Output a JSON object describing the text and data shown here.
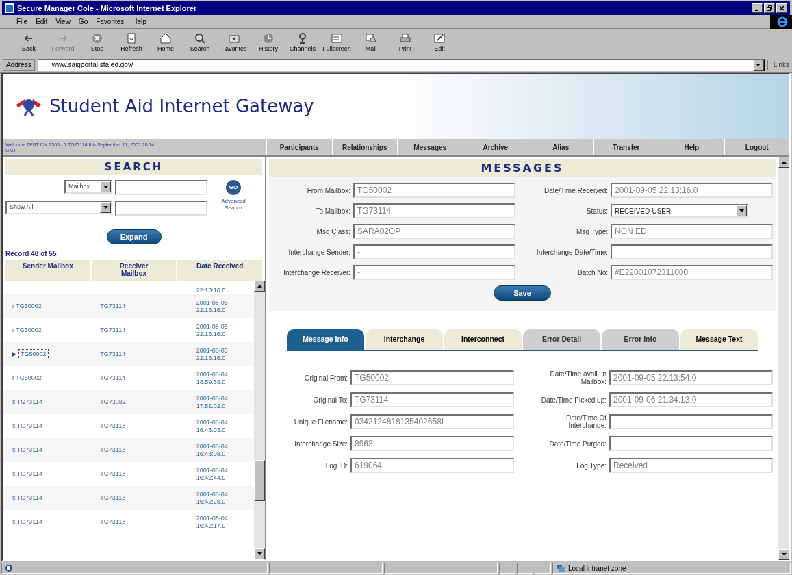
{
  "window": {
    "title": "Secure Manager Cole - Microsoft Internet Explorer"
  },
  "menu": [
    "File",
    "Edit",
    "View",
    "Go",
    "Favorites",
    "Help"
  ],
  "toolbar": [
    {
      "label": "Back",
      "kind": "back",
      "disabled": false
    },
    {
      "label": "Forward",
      "kind": "forward",
      "disabled": true
    },
    {
      "label": "Stop",
      "kind": "stop",
      "disabled": false
    },
    {
      "label": "Refresh",
      "kind": "refresh",
      "disabled": false
    },
    {
      "label": "Home",
      "kind": "home",
      "disabled": false
    },
    {
      "label": "Search",
      "kind": "search",
      "disabled": false
    },
    {
      "label": "Favorites",
      "kind": "favorites",
      "disabled": false
    },
    {
      "label": "History",
      "kind": "history",
      "disabled": false
    },
    {
      "label": "Channels",
      "kind": "channels",
      "disabled": false
    },
    {
      "label": "Fullscreen",
      "kind": "fullscreen",
      "disabled": false
    },
    {
      "label": "Mail",
      "kind": "mail",
      "disabled": false
    },
    {
      "label": "Print",
      "kind": "print",
      "disabled": false
    },
    {
      "label": "Edit",
      "kind": "edit",
      "disabled": false
    }
  ],
  "address": {
    "label": "Address",
    "value": "www.saigportal.sfa.ed.gov/",
    "links": "Links"
  },
  "site": {
    "title": "Student Aid Internet Gateway",
    "welcome": "Welcome TEST CM 2365 - 1 TG73114   It is September 17, 2001 20:14 GMT"
  },
  "nav": [
    "Participants",
    "Relationships",
    "Messages",
    "Archive",
    "Alias",
    "Transfer",
    "Help",
    "Logout"
  ],
  "search": {
    "heading": "SEARCH",
    "field_select": "Mailbox",
    "filter_select": "Show All",
    "go": "GO",
    "advanced": "Advanced Search",
    "expand": "Expand",
    "record": "Record 48 of 55",
    "columns": [
      "Sender Mailbox",
      "Receiver Mailbox",
      "Date Received"
    ],
    "rows": [
      {
        "prefix": "",
        "sender": "",
        "receiver": "",
        "date": "22:13:16.0",
        "selected": false
      },
      {
        "prefix": "r",
        "sender": "TG50002",
        "receiver": "TG73114",
        "date": "2001-08-05 22:13:16.0",
        "selected": false
      },
      {
        "prefix": "r",
        "sender": "TG50002",
        "receiver": "TG73114",
        "date": "2001-08-05 22:13:16.0",
        "selected": false
      },
      {
        "prefix": "",
        "sender": "TG50002",
        "receiver": "TG73114",
        "date": "2001-08-05 22:13:16.0",
        "selected": true
      },
      {
        "prefix": "r",
        "sender": "TG50002",
        "receiver": "TG73114",
        "date": "2001-08-04 18:59:38.0",
        "selected": false
      },
      {
        "prefix": "s",
        "sender": "TG73114",
        "receiver": "TG73082",
        "date": "2001-08-04 17:51:02.0",
        "selected": false
      },
      {
        "prefix": "s",
        "sender": "TG73114",
        "receiver": "TG73118",
        "date": "2001-08-04 16:43:03.0",
        "selected": false
      },
      {
        "prefix": "s",
        "sender": "TG73114",
        "receiver": "TG73118",
        "date": "2001-08-04 16:43:08.0",
        "selected": false
      },
      {
        "prefix": "s",
        "sender": "TG73114",
        "receiver": "TG73118",
        "date": "2001-08-04 16:42:44.0",
        "selected": false
      },
      {
        "prefix": "s",
        "sender": "TG73114",
        "receiver": "TG73118",
        "date": "2001-08-04 16:42:28.0",
        "selected": false
      },
      {
        "prefix": "s",
        "sender": "TG73114",
        "receiver": "TG73118",
        "date": "2001-08-04 16:42:17.0",
        "selected": false
      }
    ]
  },
  "messages": {
    "heading": "MESSAGES",
    "fields": [
      {
        "label": "From Mailbox:",
        "value": "TG50002",
        "kind": "text"
      },
      {
        "label": "Date/Time Received:",
        "value": "2001-09-05 22:13:16.0",
        "kind": "text"
      },
      {
        "label": "To Mailbox:",
        "value": "TG73114",
        "kind": "text"
      },
      {
        "label": "Status:",
        "value": "RECEIVED-USER",
        "kind": "select"
      },
      {
        "label": "Msg Class:",
        "value": "SARA02OP",
        "kind": "text"
      },
      {
        "label": "Msg Type:",
        "value": "NON EDI",
        "kind": "text"
      },
      {
        "label": "Interchange Sender:",
        "value": "-",
        "kind": "text"
      },
      {
        "label": "Interchange Date/Time:",
        "kind": "text"
      },
      {
        "label": "Interchange Receiver:",
        "value": "-",
        "kind": "text"
      },
      {
        "label": "Batch No:",
        "value": "#E22001072311000",
        "kind": "text"
      }
    ],
    "save": "Save",
    "tabs": [
      {
        "label": "Message Info",
        "selected": true,
        "disabled": false
      },
      {
        "label": "Interchange",
        "selected": false,
        "disabled": false
      },
      {
        "label": "Interconnect",
        "selected": false,
        "disabled": false
      },
      {
        "label": "Error Detail",
        "selected": false,
        "disabled": true
      },
      {
        "label": "Error Info",
        "selected": false,
        "disabled": true
      },
      {
        "label": "Message Text",
        "selected": false,
        "disabled": false
      }
    ],
    "info_fields": [
      {
        "label": "Original From:",
        "value": "TG50002"
      },
      {
        "label": "Date/Time avail. in Mailbox:",
        "value": "2001-09-05 22:13:54.0"
      },
      {
        "label": "Original To:",
        "value": "TG73114"
      },
      {
        "label": "Date/Time Picked up:",
        "value": "2001-09-06 21:34:13.0"
      },
      {
        "label": "Unique Filename:",
        "value": "0342124818135402658I"
      },
      {
        "label": "Date/Time Of Interchange:"
      },
      {
        "label": "Interchange Size:",
        "value": "8963"
      },
      {
        "label": "Date/Time Purged:"
      },
      {
        "label": "Log ID:",
        "value": "619064"
      },
      {
        "label": "Log Type:",
        "value": "Received"
      }
    ]
  },
  "status_bar": {
    "zone": "Local intranet zone"
  }
}
